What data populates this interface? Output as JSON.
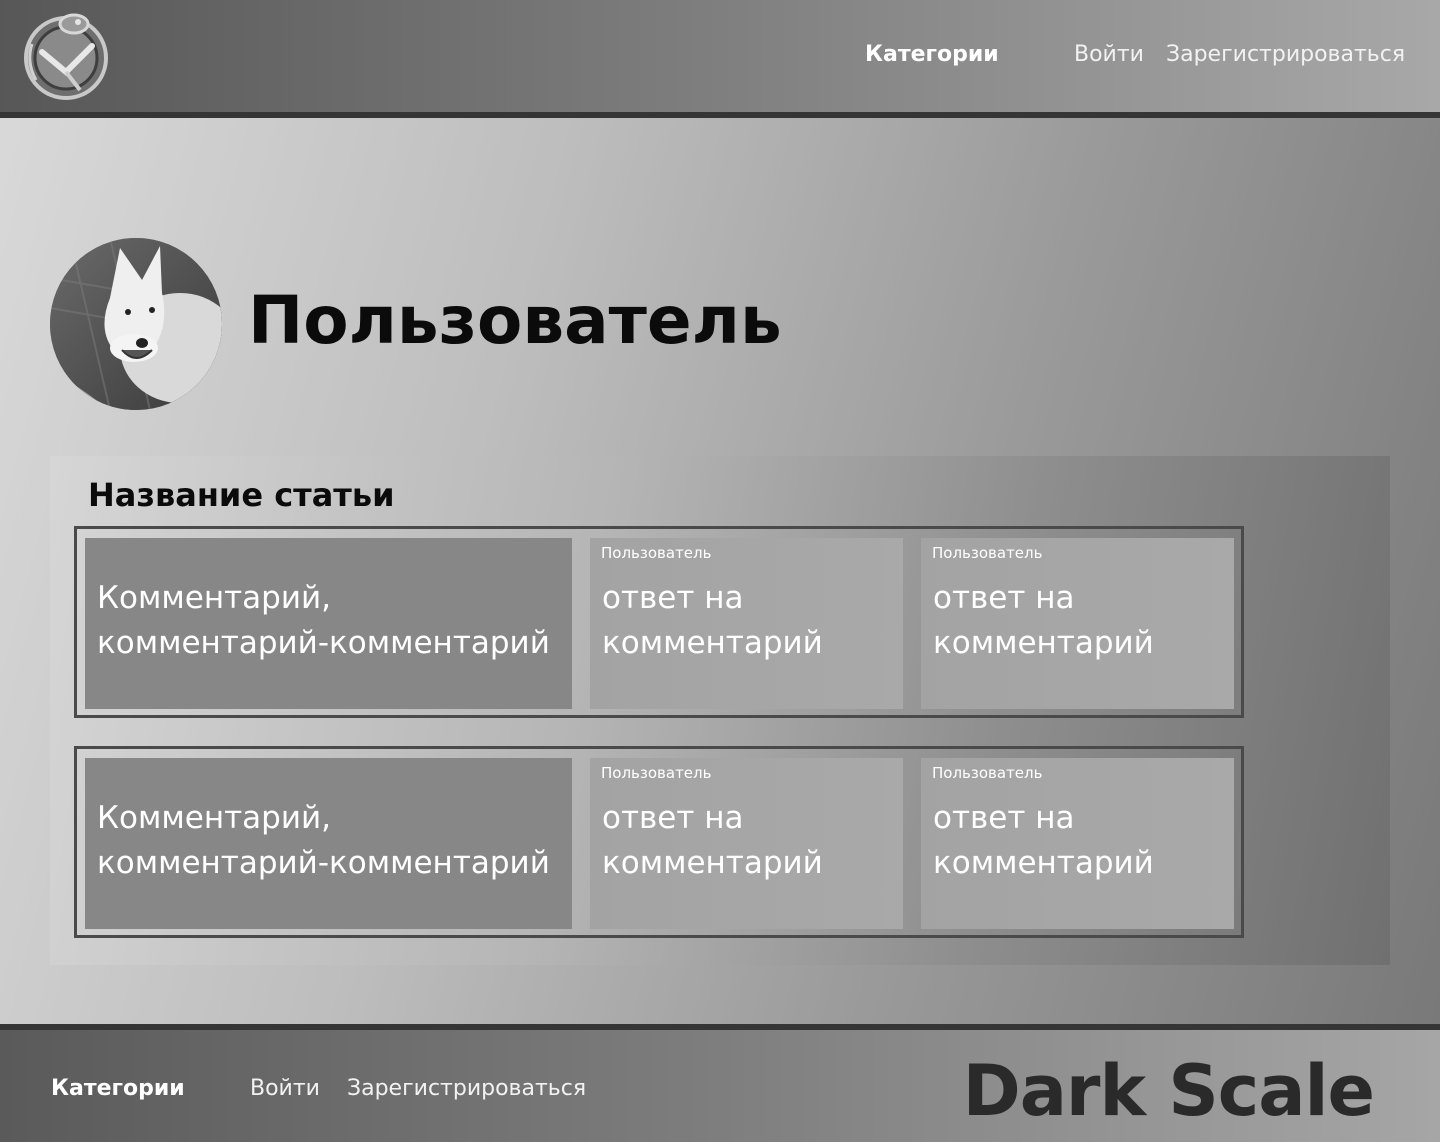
{
  "header": {
    "nav_categories": "Категории",
    "nav_login": "Войти",
    "nav_register": "Зарегистрироваться"
  },
  "profile": {
    "username": "Пользователь"
  },
  "article": {
    "title": "Название статьи",
    "threads": [
      {
        "comment_line1": "Комментарий,",
        "comment_line2": "комментарий-комментарий",
        "replies": [
          {
            "author": "Пользователь",
            "line1": "ответ на",
            "line2": "комментарий"
          },
          {
            "author": "Пользователь",
            "line1": "ответ на",
            "line2": "комментарий"
          }
        ]
      },
      {
        "comment_line1": "Комментарий,",
        "comment_line2": "комментарий-комментарий",
        "replies": [
          {
            "author": "Пользователь",
            "line1": "ответ на",
            "line2": "комментарий"
          },
          {
            "author": "Пользователь",
            "line1": "ответ на",
            "line2": "комментарий"
          }
        ]
      }
    ]
  },
  "footer": {
    "nav_categories": "Категории",
    "nav_login": "Войти",
    "nav_register": "Зарегистрироваться",
    "brand": "Dark Scale"
  },
  "icons": {
    "logo": "cat-logo-icon",
    "avatar": "dog-avatar-image"
  }
}
